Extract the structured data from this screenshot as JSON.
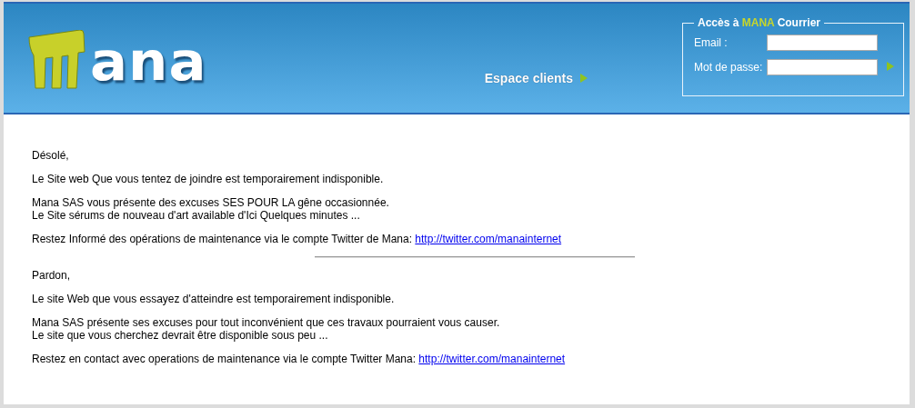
{
  "header": {
    "logo_text": "ana",
    "client_link": "Espace clients",
    "login": {
      "legend_before": "Accès à",
      "legend_brand": "MANA",
      "legend_after": "Courrier",
      "fields": [
        {
          "label": "Email :"
        },
        {
          "label": "Mot de passe:"
        }
      ]
    }
  },
  "sections": [
    {
      "paragraphs": [
        {
          "lines": [
            "Désolé,"
          ]
        },
        {
          "lines": [
            "Le Site web Que vous tentez de joindre est temporairement indisponible."
          ]
        },
        {
          "lines": [
            "Mana SAS vous présente des excuses SES POUR LA gêne occasionnée.",
            "Le Site sérums de nouveau d'art available d'Ici Quelques minutes ..."
          ]
        },
        {
          "lines": [
            "Restez Informé des opérations de maintenance via le compte Twitter de Mana:"
          ],
          "link": "http://twitter.com/manainternet"
        }
      ]
    },
    {
      "paragraphs": [
        {
          "lines": [
            "Pardon,"
          ]
        },
        {
          "lines": [
            "Le site Web que vous essayez d'atteindre est temporairement indisponible."
          ]
        },
        {
          "lines": [
            "Mana SAS présente ses excuses pour tout inconvénient que ces travaux pourraient vous causer.",
            "Le site que vous cherchez devrait être disponible sous peu ..."
          ]
        },
        {
          "lines": [
            "Restez en contact avec operations de maintenance via le compte Twitter Mana:"
          ],
          "link": "http://twitter.com/manainternet"
        }
      ]
    }
  ]
}
